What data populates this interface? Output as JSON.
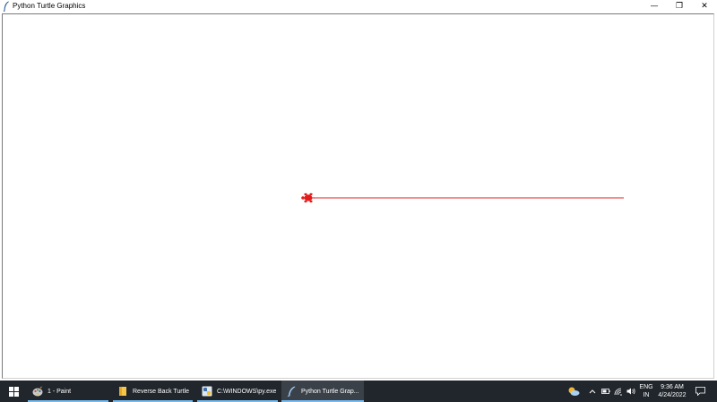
{
  "window": {
    "title": "Python Turtle Graphics",
    "minimize_glyph": "—",
    "maximize_glyph": "❐",
    "close_glyph": "✕"
  },
  "canvas": {
    "background": "#ffffff",
    "line_color": "#e31b1b",
    "turtle_color": "#e31b1b",
    "turtle_heading": "left"
  },
  "taskbar": {
    "background": "#20262c",
    "items": [
      {
        "label": "1 - Paint",
        "icon": "paint-icon",
        "active": false
      },
      {
        "label": "Reverse Back Turtle",
        "icon": "folder-icon",
        "active": false
      },
      {
        "label": "C:\\WINDOWS\\py.exe",
        "icon": "python-console-icon",
        "active": false
      },
      {
        "label": "Python Turtle Grap...",
        "icon": "python-feather-icon",
        "active": true
      }
    ],
    "tray": {
      "language_line1": "ENG",
      "language_line2": "IN",
      "time": "9:36 AM",
      "date": "4/24/2022"
    }
  }
}
